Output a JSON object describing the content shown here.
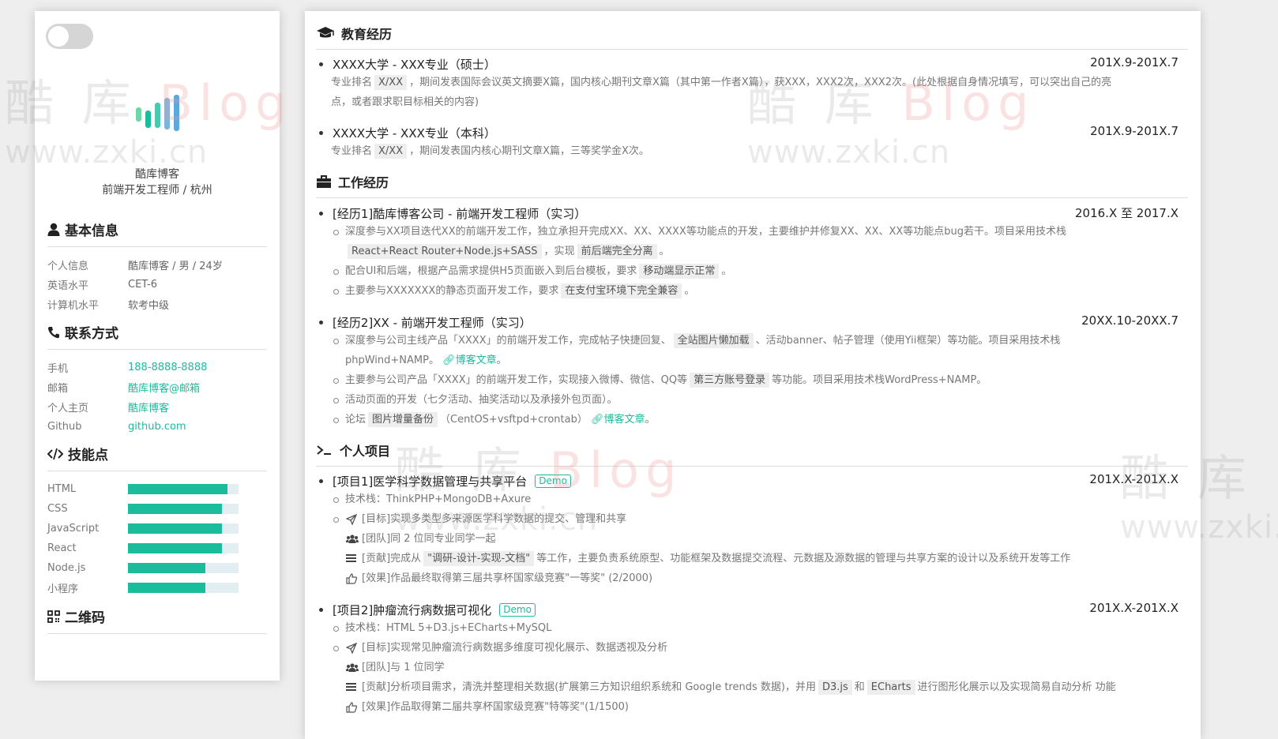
{
  "sidebar": {
    "name": "酷库博客",
    "title": "前端开发工程师 / 杭州",
    "basic": {
      "heading": "基本信息",
      "rows": [
        {
          "k": "个人信息",
          "v": "酷库博客 / 男 / 24岁"
        },
        {
          "k": "英语水平",
          "v": "CET-6"
        },
        {
          "k": "计算机水平",
          "v": "软考中级"
        }
      ]
    },
    "contact": {
      "heading": "联系方式",
      "rows": [
        {
          "k": "手机",
          "v": "188-8888-8888"
        },
        {
          "k": "邮箱",
          "v": "酷库博客@邮箱"
        },
        {
          "k": "个人主页",
          "v": "酷库博客"
        },
        {
          "k": "Github",
          "v": "github.com"
        }
      ]
    },
    "skills": {
      "heading": "技能点",
      "items": [
        {
          "k": "HTML",
          "level": 0.9
        },
        {
          "k": "CSS",
          "level": 0.85
        },
        {
          "k": "JavaScript",
          "level": 0.85
        },
        {
          "k": "React",
          "level": 0.85
        },
        {
          "k": "Node.js",
          "level": 0.7
        },
        {
          "k": "小程序",
          "level": 0.7
        }
      ]
    },
    "qrcode": {
      "heading": "二维码"
    }
  },
  "education": {
    "heading": "教育经历",
    "items": [
      {
        "title": "XXXX大学 - XXX专业（硕士）",
        "date": "201X.9-201X.7",
        "d1": "专业排名",
        "d_chip": "X/XX",
        "d2": "，期间发表国际会议英文摘要X篇，国内核心期刊文章X篇（其中第一作者X篇），获XXX，XXX2次，XXX2次。(此处根据自身情况填写，可以突出自己的亮",
        "d3": "点，或者跟求职目标相关的内容)"
      },
      {
        "title": "XXXX大学 - XXX专业（本科）",
        "date": "201X.9-201X.7",
        "d1": "专业排名",
        "d_chip": "X/XX",
        "d2": "，期间发表国内核心期刊文章X篇，三等奖学金X次。"
      }
    ]
  },
  "work": {
    "heading": "工作经历",
    "items": [
      {
        "title": "[经历1]酷库博客公司 - 前端开发工程师（实习）",
        "date": "2016.X 至 2017.X",
        "s1a": "深度参与XX项目迭代XX的前端开发工作，独立承担开完成XX、XX、XXXX等功能点的开发，主要维护并修复XX、XX、XX等功能点bug若干。项目采用技术栈",
        "s1chip": "React+React Router+Node.js+SASS",
        "s1b": "，实现",
        "s1chip2": "前后端完全分离",
        "s1c": "。",
        "s2a": "配合UI和后端，根据产品需求提供H5页面嵌入到后台模板，要求",
        "s2chip": "移动端显示正常",
        "s2b": "。",
        "s3a": "主要参与XXXXXXX的静态页面开发工作，要求",
        "s3chip": "在支付宝环境下完全兼容",
        "s3b": "。"
      },
      {
        "title": "[经历2]XX - 前端开发工程师（实习）",
        "date": "20XX.10-20XX.7",
        "s1a": "深度参与公司主线产品「XXXX」的前端开发工作，完成帖子快捷回复、",
        "s1chip": "全站图片懒加载",
        "s1b": "、活动banner、帖子管理（使用Yii框架）等功能。项目采用技术栈",
        "s1c": "phpWind+NAMP。",
        "s1link": "博客文章",
        "s1d": "。",
        "s2a": "主要参与公司产品「XXXX」的前端开发工作，实现接入微博、微信、QQ等",
        "s2chip": "第三方账号登录",
        "s2b": "等功能。项目采用技术栈WordPress+NAMP。",
        "s3": "活动页面的开发（七夕活动、抽奖活动以及承接外包页面）。",
        "s4a": "论坛",
        "s4chip": "图片增量备份",
        "s4b": "（CentOS+vsftpd+crontab）",
        "s4link": "博客文章",
        "s4c": "。"
      }
    ]
  },
  "projects": {
    "heading": "个人项目",
    "items": [
      {
        "title": "[项目1]医学科学数据管理与共享平台",
        "badge": "Demo",
        "date": "201X.X-201X.X",
        "stack": "技术栈：ThinkPHP+MongoDB+Axure",
        "goal": "[目标]实现多类型多来源医学科学数据的提交、管理和共享",
        "team": "[团队]同 2 位同专业同学一起",
        "contrib_a": "[贡献]完成从",
        "contrib_chip": "\"调研-设计-实现-文档\"",
        "contrib_b": "等工作，主要负责系统原型、功能框架及数据提交流程、元数据及源数据的管理与共享方案的设计以及系统开发等工作",
        "effect": "[效果]作品最终取得第三届共享杯国家级竞赛\"一等奖\" (2/2000)"
      },
      {
        "title": "[项目2]肿瘤流行病数据可视化",
        "badge": "Demo",
        "date": "201X.X-201X.X",
        "stack": "技术栈：HTML 5+D3.js+ECharts+MySQL",
        "goal": "[目标]实现常见肿瘤流行病数据多维度可视化展示、数据透视及分析",
        "team": "[团队]与 1 位同学",
        "contrib_a": "[贡献]分析项目需求，清洗并整理相关数据(扩展第三方知识组织系统和 Google trends 数据)，并用",
        "contrib_chip": "D3.js",
        "contrib_mid": "和",
        "contrib_chip2": "ECharts",
        "contrib_b": "进行图形化展示以及实现简易自动分析 功能",
        "effect": "[效果]作品取得第二届共享杯国家级竞赛\"特等奖\"(1/1500)"
      }
    ]
  },
  "watermark": {
    "brand": "酷 库 ",
    "brand_b": "Blog",
    "url": "www.zxki.cn"
  },
  "colors": {
    "accent": "#1abc9c",
    "bar_bg": "#e3eef3"
  }
}
